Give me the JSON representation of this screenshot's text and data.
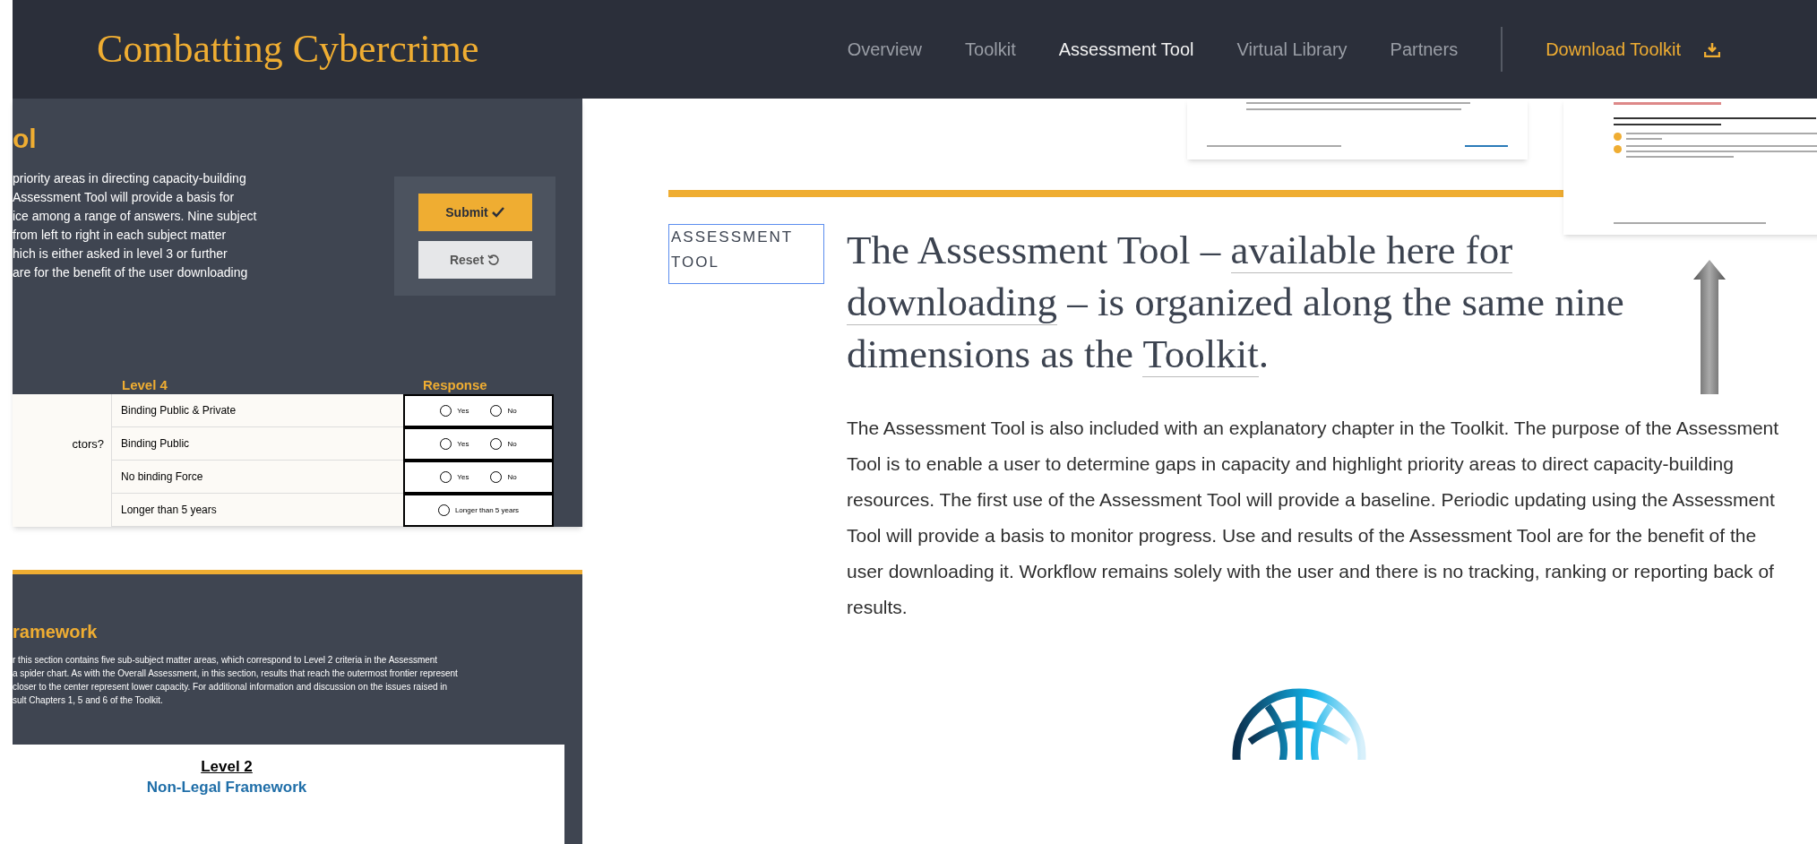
{
  "header": {
    "logo": "Combatting Cybercrime",
    "nav": [
      {
        "label": "Overview",
        "selected": false
      },
      {
        "label": "Toolkit",
        "selected": false
      },
      {
        "label": "Assessment Tool",
        "selected": true
      },
      {
        "label": "Virtual Library",
        "selected": false
      },
      {
        "label": "Partners",
        "selected": false
      }
    ],
    "download": "Download Toolkit"
  },
  "assessment_form_preview": {
    "title": "ol",
    "intro_lines": [
      "priority areas in directing capacity-building",
      "Assessment Tool will provide a basis for",
      "ice among a range of answers. Nine subject",
      "from left to right in each subject matter",
      "hich is either asked in level 3 or further",
      "are for the benefit of the user downloading"
    ],
    "buttons": [
      {
        "label": "Submit",
        "kind": "primary"
      },
      {
        "label": "Reset",
        "kind": "secondary"
      }
    ],
    "columns": [
      "Level 4",
      "Response"
    ],
    "rows": [
      {
        "question": "",
        "answer": "Binding Public & Private",
        "options": [
          {
            "label": "Yes",
            "selected": false
          },
          {
            "label": "No",
            "selected": false
          }
        ]
      },
      {
        "question": "ctors?",
        "answer": "Binding Public",
        "options": [
          {
            "label": "Yes",
            "selected": false
          },
          {
            "label": "No",
            "selected": false
          }
        ]
      },
      {
        "question": "",
        "answer": "No binding Force",
        "options": [
          {
            "label": "Yes",
            "selected": false
          },
          {
            "label": "No",
            "selected": false
          }
        ]
      },
      {
        "question": "",
        "answer": "Longer than 5 years",
        "options": [
          {
            "label": "Longer than 5 years",
            "selected": false
          }
        ]
      }
    ]
  },
  "framework_preview": {
    "title": "ramework",
    "lines": [
      "r this section contains five sub-subject matter areas, which correspond to Level 2 criteria in the Assessment",
      "a spider chart. As with the Overall Assessment, in this section, results that reach the outermost frontier represent",
      "closer to the center represent lower capacity. For additional information and discussion on the issues raised in",
      "sult Chapters 1, 5 and 6 of the Toolkit."
    ],
    "card_heading": "Level 2",
    "card_subtitle": "Non-Legal Framework"
  },
  "section": {
    "label": "ASSESSMENT TOOL",
    "heading": [
      {
        "kind": "text",
        "text": "The Assessment Tool – "
      },
      {
        "kind": "link",
        "text": "available here for"
      },
      {
        "kind": "link",
        "text": "downloading"
      },
      {
        "kind": "text",
        "text": " – is organized along the same nine dimensions as the "
      },
      {
        "kind": "link",
        "text": "Toolkit"
      },
      {
        "kind": "text",
        "text": "."
      }
    ],
    "body": "The Assessment Tool is also included with an explanatory chapter in the Toolkit. The purpose of the Assessment Tool is to enable a user to determine gaps in capacity and highlight priority areas to direct capacity-building resources. The first use of the Assessment Tool will provide a baseline. Periodic updating using the Assessment Tool will provide a basis to monitor progress. Use and results of the Assessment Tool are for the benefit of the user downloading it. Workflow remains solely with the user and there is no tracking, ranking or reporting back of results."
  }
}
